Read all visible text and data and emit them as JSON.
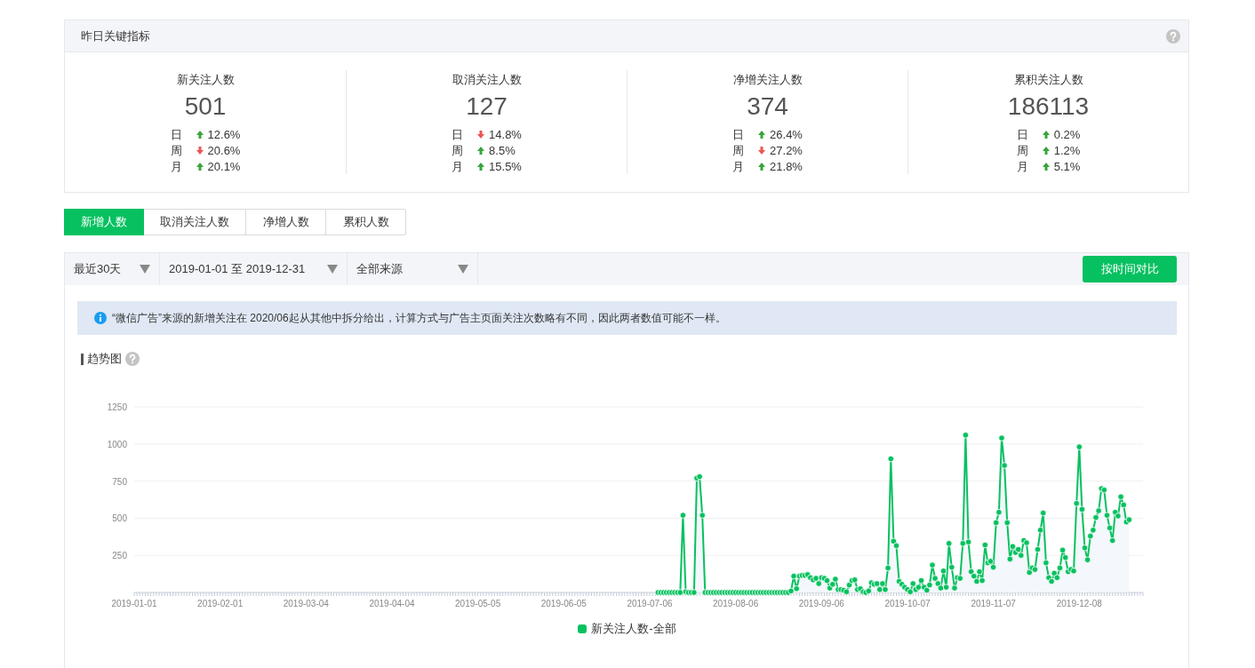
{
  "metrics_panel": {
    "title": "昨日关键指标",
    "metrics": [
      {
        "label": "新关注人数",
        "value": "501",
        "changes": [
          {
            "period": "日",
            "increase": true,
            "percent": "12.6%"
          },
          {
            "period": "周",
            "increase": false,
            "percent": "20.6%"
          },
          {
            "period": "月",
            "increase": true,
            "percent": "20.1%"
          }
        ]
      },
      {
        "label": "取消关注人数",
        "value": "127",
        "changes": [
          {
            "period": "日",
            "increase": false,
            "percent": "14.8%"
          },
          {
            "period": "周",
            "increase": true,
            "percent": "8.5%"
          },
          {
            "period": "月",
            "increase": true,
            "percent": "15.5%"
          }
        ]
      },
      {
        "label": "净增关注人数",
        "value": "374",
        "changes": [
          {
            "period": "日",
            "increase": true,
            "percent": "26.4%"
          },
          {
            "period": "周",
            "increase": false,
            "percent": "27.2%"
          },
          {
            "period": "月",
            "increase": true,
            "percent": "21.8%"
          }
        ]
      },
      {
        "label": "累积关注人数",
        "value": "186113",
        "changes": [
          {
            "period": "日",
            "increase": true,
            "percent": "0.2%"
          },
          {
            "period": "周",
            "increase": true,
            "percent": "1.2%"
          },
          {
            "period": "月",
            "increase": true,
            "percent": "5.1%"
          }
        ]
      }
    ]
  },
  "tabs": [
    {
      "label": "新增人数",
      "selected": true
    },
    {
      "label": "取消关注人数",
      "selected": false
    },
    {
      "label": "净增人数",
      "selected": false
    },
    {
      "label": "累积人数",
      "selected": false
    }
  ],
  "filters": {
    "range": "最近30天",
    "dates": "2019-01-01 至 2019-12-31",
    "source": "全部来源",
    "compare_button": "按时间对比"
  },
  "notice": "“微信广告”来源的新增关注在 2020/06起从其他中拆分给出，计算方式与广告主页面关注次数略有不同，因此两者数值可能不一样。",
  "trend": {
    "title": "趋势图",
    "chart_data": {
      "type": "line",
      "grid": true,
      "ylim": [
        0,
        1250
      ],
      "yticks": [
        250,
        500,
        750,
        1000,
        1250
      ],
      "categories": [
        "2019-01-01",
        null,
        null,
        null,
        null,
        null,
        null,
        null,
        null,
        null,
        null,
        null,
        null,
        null,
        null,
        null,
        null,
        null,
        null,
        null,
        null,
        null,
        null,
        null,
        null,
        null,
        null,
        null,
        null,
        null,
        null,
        "2019-02-01",
        null,
        null,
        null,
        null,
        null,
        null,
        null,
        null,
        null,
        null,
        null,
        null,
        null,
        null,
        null,
        null,
        null,
        null,
        null,
        null,
        null,
        null,
        null,
        null,
        null,
        null,
        null,
        null,
        null,
        null,
        "2019-03-04",
        null,
        null,
        null,
        null,
        null,
        null,
        null,
        null,
        null,
        null,
        null,
        null,
        null,
        null,
        null,
        null,
        null,
        null,
        null,
        null,
        null,
        null,
        null,
        null,
        null,
        null,
        null,
        null,
        null,
        null,
        "2019-04-04",
        null,
        null,
        null,
        null,
        null,
        null,
        null,
        null,
        null,
        null,
        null,
        null,
        null,
        null,
        null,
        null,
        null,
        null,
        null,
        null,
        null,
        null,
        null,
        null,
        null,
        null,
        null,
        null,
        null,
        null,
        "2019-05-05",
        null,
        null,
        null,
        null,
        null,
        null,
        null,
        null,
        null,
        null,
        null,
        null,
        null,
        null,
        null,
        null,
        null,
        null,
        null,
        null,
        null,
        null,
        null,
        null,
        null,
        null,
        null,
        null,
        null,
        null,
        "2019-06-05",
        null,
        null,
        null,
        null,
        null,
        null,
        null,
        null,
        null,
        null,
        null,
        null,
        null,
        null,
        null,
        null,
        null,
        null,
        null,
        null,
        null,
        null,
        null,
        null,
        null,
        null,
        null,
        null,
        null,
        null,
        "2019-07-06",
        null,
        null,
        null,
        null,
        null,
        null,
        null,
        null,
        null,
        null,
        null,
        null,
        null,
        null,
        null,
        null,
        null,
        null,
        null,
        null,
        null,
        null,
        null,
        null,
        null,
        null,
        null,
        null,
        null,
        null,
        "2019-08-06",
        null,
        null,
        null,
        null,
        null,
        null,
        null,
        null,
        null,
        null,
        null,
        null,
        null,
        null,
        null,
        null,
        null,
        null,
        null,
        null,
        null,
        null,
        null,
        null,
        null,
        null,
        null,
        null,
        null,
        null,
        "2019-09-06",
        null,
        null,
        null,
        null,
        null,
        null,
        null,
        null,
        null,
        null,
        null,
        null,
        null,
        null,
        null,
        null,
        null,
        null,
        null,
        null,
        null,
        null,
        null,
        null,
        null,
        null,
        null,
        null,
        null,
        null,
        "2019-10-07",
        null,
        null,
        null,
        null,
        null,
        null,
        null,
        null,
        null,
        null,
        null,
        null,
        null,
        null,
        null,
        null,
        null,
        null,
        null,
        null,
        null,
        null,
        null,
        null,
        null,
        null,
        null,
        null,
        null,
        null,
        "2019-11-07",
        null,
        null,
        null,
        null,
        null,
        null,
        null,
        null,
        null,
        null,
        null,
        null,
        null,
        null,
        null,
        null,
        null,
        null,
        null,
        null,
        null,
        null,
        null,
        null,
        null,
        null,
        null,
        null,
        null,
        null,
        "2019-12-08",
        null,
        null,
        null,
        null,
        null,
        null,
        null,
        null,
        null,
        null,
        null,
        null,
        null,
        null,
        null,
        null,
        null,
        null,
        null,
        null,
        null,
        null,
        null
      ],
      "series": [
        {
          "name": "新关注人数-全部",
          "color": "#07c160",
          "marker": true,
          "values": [
            null,
            null,
            null,
            null,
            null,
            null,
            null,
            null,
            null,
            null,
            null,
            null,
            null,
            null,
            null,
            null,
            null,
            null,
            null,
            null,
            null,
            null,
            null,
            null,
            null,
            null,
            null,
            null,
            null,
            null,
            null,
            null,
            null,
            null,
            null,
            null,
            null,
            null,
            null,
            null,
            null,
            null,
            null,
            null,
            null,
            null,
            null,
            null,
            null,
            null,
            null,
            null,
            null,
            null,
            null,
            null,
            null,
            null,
            null,
            null,
            null,
            null,
            null,
            null,
            null,
            null,
            null,
            null,
            null,
            null,
            null,
            null,
            null,
            null,
            null,
            null,
            null,
            null,
            null,
            null,
            null,
            null,
            null,
            null,
            null,
            null,
            null,
            null,
            null,
            null,
            null,
            null,
            null,
            null,
            null,
            null,
            null,
            null,
            null,
            null,
            null,
            null,
            null,
            null,
            null,
            null,
            null,
            null,
            null,
            null,
            null,
            null,
            null,
            null,
            null,
            null,
            null,
            null,
            null,
            null,
            null,
            null,
            null,
            null,
            null,
            null,
            null,
            null,
            null,
            null,
            null,
            null,
            null,
            null,
            null,
            null,
            null,
            null,
            null,
            null,
            null,
            null,
            null,
            null,
            null,
            null,
            null,
            null,
            null,
            null,
            null,
            null,
            null,
            null,
            null,
            null,
            null,
            null,
            null,
            null,
            null,
            null,
            null,
            null,
            null,
            null,
            null,
            null,
            null,
            null,
            null,
            null,
            null,
            null,
            null,
            null,
            null,
            null,
            null,
            null,
            null,
            null,
            null,
            null,
            null,
            null,
            null,
            null,
            null,
            0,
            0,
            0,
            0,
            0,
            0,
            0,
            0,
            0,
            520,
            5,
            0,
            0,
            0,
            770,
            780,
            520,
            0,
            0,
            0,
            0,
            0,
            0,
            0,
            0,
            0,
            0,
            0,
            0,
            0,
            0,
            0,
            0,
            0,
            0,
            0,
            0,
            0,
            0,
            0,
            0,
            0,
            0,
            0,
            0,
            0,
            0,
            0,
            10,
            110,
            25,
            110,
            115,
            115,
            120,
            100,
            85,
            95,
            60,
            100,
            95,
            80,
            30,
            55,
            90,
            20,
            20,
            15,
            5,
            50,
            80,
            85,
            20,
            25,
            5,
            0,
            10,
            65,
            55,
            60,
            20,
            60,
            20,
            165,
            900,
            345,
            315,
            75,
            55,
            35,
            20,
            5,
            60,
            20,
            35,
            80,
            35,
            15,
            50,
            185,
            95,
            60,
            30,
            145,
            35,
            330,
            170,
            30,
            100,
            95,
            330,
            1060,
            340,
            140,
            110,
            75,
            140,
            80,
            320,
            200,
            210,
            170,
            470,
            540,
            1040,
            855,
            470,
            225,
            310,
            270,
            290,
            250,
            350,
            335,
            135,
            165,
            155,
            290,
            420,
            535,
            200,
            100,
            75,
            130,
            100,
            165,
            285,
            235,
            140,
            155,
            145,
            600,
            980,
            560,
            300,
            220,
            380,
            420,
            505,
            550,
            700,
            690,
            520,
            435,
            350,
            540,
            515,
            645,
            590,
            475,
            490,
            null,
            null,
            null,
            null,
            null
          ]
        }
      ]
    }
  }
}
